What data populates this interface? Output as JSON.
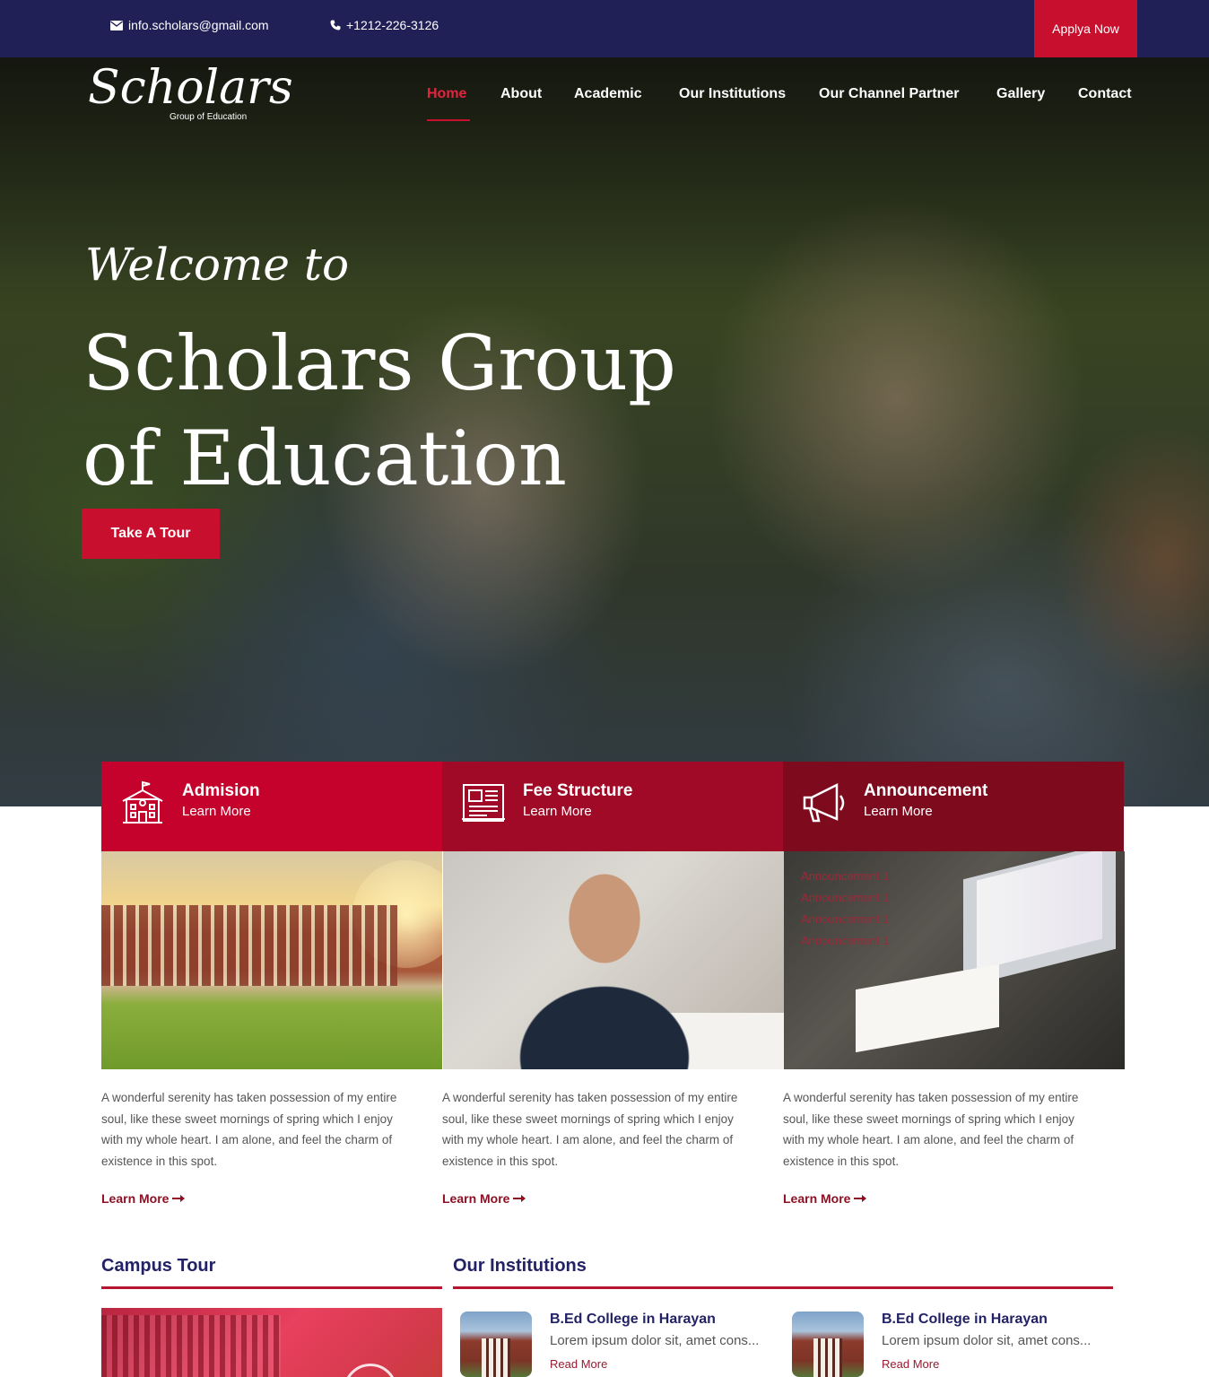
{
  "topbar": {
    "email": "info.scholars@gmail.com",
    "phone": "+1212-226-3126",
    "apply_label": "Applya Now"
  },
  "brand": {
    "name": "Scholars",
    "tagline": "Group of Education"
  },
  "nav": {
    "items": [
      {
        "label": "Home",
        "active": true
      },
      {
        "label": "About"
      },
      {
        "label": "Academic"
      },
      {
        "label": "Our Institutions"
      },
      {
        "label": "Our Channel Partner"
      },
      {
        "label": "Gallery"
      },
      {
        "label": "Contact"
      }
    ]
  },
  "hero": {
    "welcome": "Welcome to",
    "headline": "Scholars Group of Education",
    "cta_label": "Take A Tour"
  },
  "features": [
    {
      "title": "Admision",
      "link": "Learn More",
      "icon": "school-building-icon",
      "header_color": "#c4022b",
      "text": "A wonderful serenity has taken possession of my entire soul, like these sweet mornings of spring which I enjoy with my whole heart. I am alone, and feel the charm of existence in this spot.",
      "more": "Learn More"
    },
    {
      "title": "Fee Structure",
      "link": "Learn More",
      "icon": "newspaper-icon",
      "header_color": "#a10a26",
      "text": "A wonderful serenity has taken possession of my entire soul, like these sweet mornings of spring which I enjoy with my whole heart. I am alone, and feel the charm of existence in this spot.",
      "more": "Learn More"
    },
    {
      "title": "Announcement",
      "link": "Learn More",
      "icon": "megaphone-icon",
      "header_color": "#7e0a1e",
      "text": "A wonderful serenity has taken possession of my entire soul, like these sweet mornings of spring which I enjoy with my whole heart. I am alone, and feel the charm of existence in this spot.",
      "more": "Learn More",
      "announcements": [
        "Announcement 1",
        "Announcement 1",
        "Announcement 1",
        "Announcement 1"
      ]
    }
  ],
  "campus": {
    "title": "Campus Tour"
  },
  "institutions": {
    "title": "Our Institutions",
    "items": [
      {
        "name": "B.Ed College in Harayan",
        "desc": "Lorem ipsum dolor sit, amet cons...",
        "read": "Read More"
      },
      {
        "name": "B.Ed College in Harayan",
        "desc": "Lorem ipsum dolor sit, amet cons...",
        "read": "Read More"
      }
    ]
  },
  "colors": {
    "topbar": "#201f56",
    "accent": "#c8102e",
    "heading": "#232265"
  }
}
